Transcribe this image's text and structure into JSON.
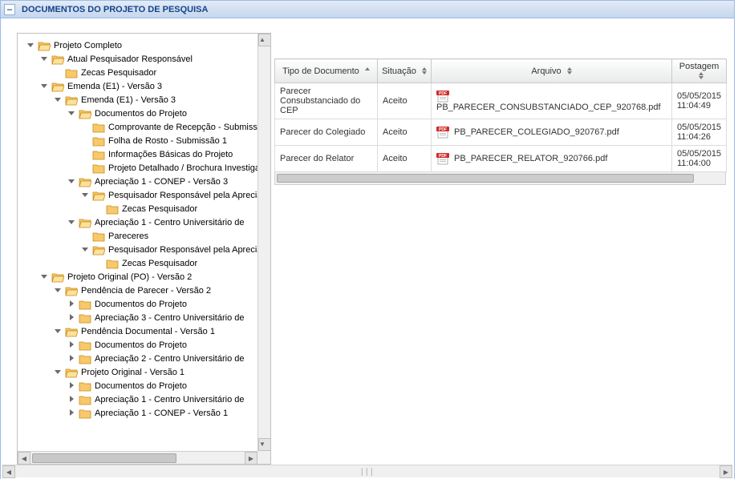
{
  "panel": {
    "title": "DOCUMENTOS DO PROJETO DE PESQUISA",
    "collapse_symbol": "−"
  },
  "tree": [
    {
      "depth": 0,
      "toggle": "expanded",
      "icon": "folder-open",
      "label": "Projeto Completo"
    },
    {
      "depth": 1,
      "toggle": "expanded",
      "icon": "folder-open",
      "label": "Atual Pesquisador Responsável"
    },
    {
      "depth": 2,
      "toggle": "none",
      "icon": "folder",
      "label": "Zecas Pesquisador"
    },
    {
      "depth": 1,
      "toggle": "expanded",
      "icon": "folder-open",
      "label": "Emenda (E1) - Versão 3"
    },
    {
      "depth": 2,
      "toggle": "expanded",
      "icon": "folder-open",
      "label": "Emenda (E1) - Versão 3"
    },
    {
      "depth": 3,
      "toggle": "expanded",
      "icon": "folder-open",
      "label": "Documentos do Projeto"
    },
    {
      "depth": 4,
      "toggle": "none",
      "icon": "folder",
      "label": "Comprovante de Recepção - Submissão"
    },
    {
      "depth": 4,
      "toggle": "none",
      "icon": "folder",
      "label": "Folha de Rosto - Submissão 1"
    },
    {
      "depth": 4,
      "toggle": "none",
      "icon": "folder",
      "label": "Informações Básicas do Projeto"
    },
    {
      "depth": 4,
      "toggle": "none",
      "icon": "folder",
      "label": "Projeto Detalhado / Brochura Investigador"
    },
    {
      "depth": 3,
      "toggle": "expanded",
      "icon": "folder-open",
      "label": "Apreciação 1 - CONEP - Versão 3"
    },
    {
      "depth": 4,
      "toggle": "expanded",
      "icon": "folder-open",
      "label": "Pesquisador Responsável pela Apreciação"
    },
    {
      "depth": 5,
      "toggle": "none",
      "icon": "folder",
      "label": "Zecas Pesquisador"
    },
    {
      "depth": 3,
      "toggle": "expanded",
      "icon": "folder-open",
      "label": "Apreciação 1 - Centro Universitário de"
    },
    {
      "depth": 4,
      "toggle": "none",
      "icon": "folder",
      "label": "Pareceres"
    },
    {
      "depth": 4,
      "toggle": "expanded",
      "icon": "folder-open",
      "label": "Pesquisador Responsável pela Apreciação"
    },
    {
      "depth": 5,
      "toggle": "none",
      "icon": "folder",
      "label": "Zecas Pesquisador"
    },
    {
      "depth": 1,
      "toggle": "expanded",
      "icon": "folder-open",
      "label": "Projeto Original (PO) - Versão 2"
    },
    {
      "depth": 2,
      "toggle": "expanded",
      "icon": "folder-open",
      "label": "Pendência de Parecer - Versão 2"
    },
    {
      "depth": 3,
      "toggle": "collapsed",
      "icon": "folder",
      "label": "Documentos do Projeto"
    },
    {
      "depth": 3,
      "toggle": "collapsed",
      "icon": "folder",
      "label": "Apreciação 3 - Centro Universitário de"
    },
    {
      "depth": 2,
      "toggle": "expanded",
      "icon": "folder-open",
      "label": "Pendência Documental - Versão 1"
    },
    {
      "depth": 3,
      "toggle": "collapsed",
      "icon": "folder",
      "label": "Documentos do Projeto"
    },
    {
      "depth": 3,
      "toggle": "collapsed",
      "icon": "folder",
      "label": "Apreciação 2 - Centro Universitário de"
    },
    {
      "depth": 2,
      "toggle": "expanded",
      "icon": "folder-open",
      "label": "Projeto Original - Versão 1"
    },
    {
      "depth": 3,
      "toggle": "collapsed",
      "icon": "folder",
      "label": "Documentos do Projeto"
    },
    {
      "depth": 3,
      "toggle": "collapsed",
      "icon": "folder",
      "label": "Apreciação 1 - Centro Universitário de"
    },
    {
      "depth": 3,
      "toggle": "collapsed",
      "icon": "folder",
      "label": "Apreciação 1 - CONEP - Versão 1"
    }
  ],
  "table": {
    "columns": {
      "tipo": "Tipo de Documento",
      "situacao": "Situação",
      "arquivo": "Arquivo",
      "postagem": "Postagem"
    },
    "rows": [
      {
        "tipo": "Parecer Consubstanciado do CEP",
        "situacao": "Aceito",
        "arquivo": "PB_PARECER_CONSUBSTANCIADO_CEP_920768.pdf",
        "postagem_date": "05/05/2015",
        "postagem_time": "11:04:49"
      },
      {
        "tipo": "Parecer do Colegiado",
        "situacao": "Aceito",
        "arquivo": "PB_PARECER_COLEGIADO_920767.pdf",
        "postagem_date": "05/05/2015",
        "postagem_time": "11:04:26"
      },
      {
        "tipo": "Parecer do Relator",
        "situacao": "Aceito",
        "arquivo": "PB_PARECER_RELATOR_920766.pdf",
        "postagem_date": "05/05/2015",
        "postagem_time": "11:04:00"
      }
    ]
  }
}
